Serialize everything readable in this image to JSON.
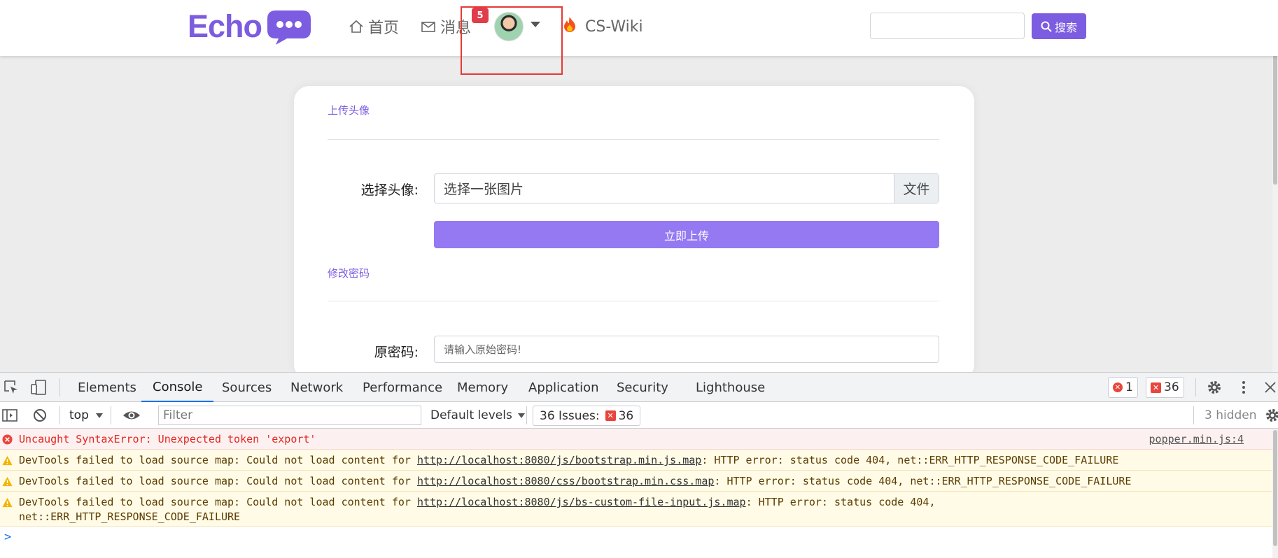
{
  "navbar": {
    "logo_text": "Echo",
    "home_label": "首页",
    "messages_label": "消息",
    "notification_count": "5",
    "wiki_label": "CS-Wiki",
    "search_placeholder": "",
    "search_button_label": "搜索"
  },
  "settings": {
    "avatar_section_title": "上传头像",
    "choose_avatar_label": "选择头像:",
    "file_placeholder": "选择一张图片",
    "file_button_label": "文件",
    "upload_button_label": "立即上传",
    "password_section_title": "修改密码",
    "old_password_label": "原密码:",
    "old_password_placeholder": "请输入原始密码!"
  },
  "devtools": {
    "tabs": [
      "Elements",
      "Console",
      "Sources",
      "Network",
      "Performance",
      "Memory",
      "Application",
      "Security",
      "Lighthouse"
    ],
    "active_tab": "Console",
    "error_count": "1",
    "issue_count": "36",
    "context": "top",
    "filter_placeholder": "Filter",
    "levels_label": "Default levels",
    "issues_label": "36 Issues:",
    "issues_badge_count": "36",
    "hidden_label": "3 hidden",
    "messages": [
      {
        "level": "error",
        "text": "Uncaught SyntaxError: Unexpected token 'export'",
        "source": "popper.min.js:4"
      },
      {
        "level": "warning",
        "prefix": "DevTools failed to load source map: Could not load content for ",
        "url": "http://localhost:8080/js/bootstrap.min.js.map",
        "suffix": ": HTTP error: status code 404, net::ERR_HTTP_RESPONSE_CODE_FAILURE"
      },
      {
        "level": "warning",
        "prefix": "DevTools failed to load source map: Could not load content for ",
        "url": "http://localhost:8080/css/bootstrap.min.css.map",
        "suffix": ": HTTP error: status code 404, net::ERR_HTTP_RESPONSE_CODE_FAILURE"
      },
      {
        "level": "warning",
        "prefix": "DevTools failed to load source map: Could not load content for ",
        "url": "http://localhost:8080/js/bs-custom-file-input.js.map",
        "suffix": ": HTTP error: status code 404,",
        "continuation": "net::ERR_HTTP_RESPONSE_CODE_FAILURE"
      }
    ],
    "prompt_symbol": ">"
  },
  "colors": {
    "brand": "#7c5ce0",
    "upload_button": "#9479f3",
    "highlight_box": "#e53935",
    "badge": "#e03c4a",
    "console_error": "#e0281f"
  },
  "icons": [
    "home-icon",
    "envelope-icon",
    "flame-icon",
    "search-icon",
    "inspect-icon",
    "device-toggle-icon",
    "settings-gear-icon",
    "kebab-menu-icon",
    "close-icon",
    "sidebar-toggle-icon",
    "clear-console-icon",
    "eye-icon",
    "error-icon",
    "warning-icon"
  ]
}
